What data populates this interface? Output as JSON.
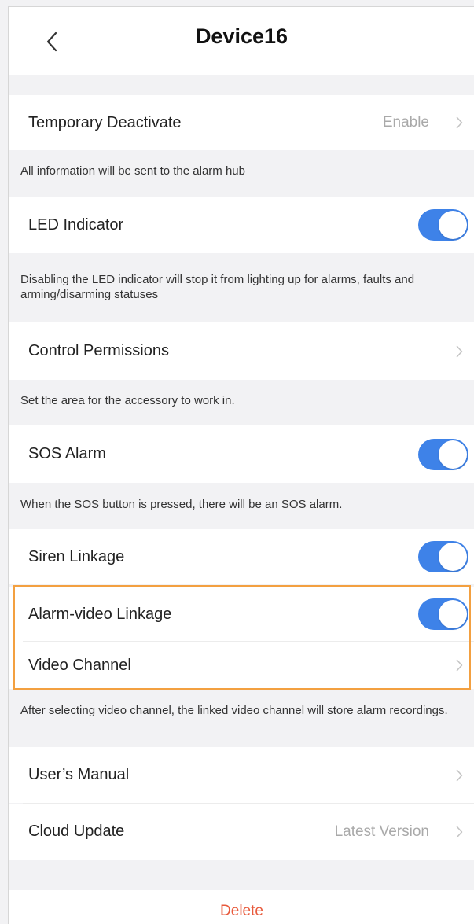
{
  "header": {
    "title": "Device16"
  },
  "rows": {
    "temporary_deactivate": {
      "label": "Temporary Deactivate",
      "value": "Enable"
    },
    "led_indicator": {
      "label": "LED Indicator",
      "toggle": "on"
    },
    "control_permissions": {
      "label": "Control Permissions"
    },
    "sos_alarm": {
      "label": "SOS Alarm",
      "toggle": "on"
    },
    "siren_linkage": {
      "label": "Siren Linkage",
      "toggle": "on"
    },
    "alarm_video_linkage": {
      "label": "Alarm-video Linkage",
      "toggle": "on"
    },
    "video_channel": {
      "label": "Video Channel"
    },
    "users_manual": {
      "label": "User’s Manual"
    },
    "cloud_update": {
      "label": "Cloud Update",
      "value": "Latest Version"
    }
  },
  "notes": {
    "temporary_deactivate": "All information will be sent to the alarm hub",
    "led_indicator": "Disabling the LED indicator will stop it from lighting up for alarms, faults and arming/disarming statuses",
    "control_permissions": "Set the area for the accessory to work in.",
    "sos_alarm": "When the SOS button is pressed, there will be an SOS alarm.",
    "video_channel": "After selecting video channel, the linked video channel will store alarm recordings."
  },
  "delete_label": "Delete",
  "colors": {
    "toggle_on": "#3e82e8",
    "delete": "#e85a3c",
    "highlight_border": "#f3a040",
    "background": "#f2f2f4"
  },
  "icons": {
    "back": "chevron-left-icon",
    "row_arrow": "chevron-right-icon"
  }
}
